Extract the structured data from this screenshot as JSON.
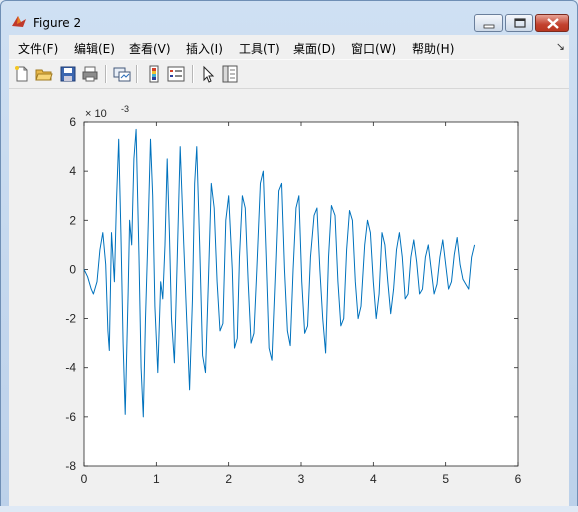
{
  "window": {
    "title": "Figure 2"
  },
  "menus": [
    {
      "label": "文件(F)",
      "key": "file"
    },
    {
      "label": "编辑(E)",
      "key": "edit"
    },
    {
      "label": "查看(V)",
      "key": "view"
    },
    {
      "label": "插入(I)",
      "key": "insert"
    },
    {
      "label": "工具(T)",
      "key": "tools"
    },
    {
      "label": "桌面(D)",
      "key": "desktop"
    },
    {
      "label": "窗口(W)",
      "key": "window"
    },
    {
      "label": "帮助(H)",
      "key": "help"
    }
  ],
  "toolbar": {
    "buttons": [
      "new-figure-icon",
      "open-file-icon",
      "save-icon",
      "print-icon",
      "link-plot-icon",
      "insert-colorbar-icon",
      "insert-legend-icon",
      "edit-plot-arrow-icon",
      "property-inspector-icon"
    ]
  },
  "colors": {
    "line": "#0072bd",
    "axes_bg": "#ffffff",
    "figure_bg": "#f0f0f0"
  },
  "chart_data": {
    "type": "line",
    "exponent_label": "× 10",
    "exponent_power": "-3",
    "xlim": [
      0,
      6
    ],
    "ylim": [
      -8,
      6
    ],
    "x_ticks": [
      "0",
      "1",
      "2",
      "3",
      "4",
      "5",
      "6"
    ],
    "y_ticks": [
      "6",
      "4",
      "2",
      "0",
      "-2",
      "-4",
      "-6",
      "-8"
    ],
    "series": [
      {
        "x": [
          0,
          0.05,
          0.1,
          0.13,
          0.18,
          0.22,
          0.26,
          0.3,
          0.33,
          0.35,
          0.38,
          0.42,
          0.45,
          0.48,
          0.51,
          0.54,
          0.57,
          0.61,
          0.63,
          0.66,
          0.69,
          0.72,
          0.76,
          0.79,
          0.82,
          0.85,
          0.88,
          0.92,
          0.95,
          0.98,
          1.02,
          1.06,
          1.09,
          1.12,
          1.15,
          1.18,
          1.21,
          1.25,
          1.29,
          1.33,
          1.38,
          1.42,
          1.46,
          1.5,
          1.53,
          1.56,
          1.6,
          1.64,
          1.68,
          1.72,
          1.76,
          1.8,
          1.84,
          1.88,
          1.92,
          1.96,
          2.0,
          2.05,
          2.08,
          2.12,
          2.15,
          2.19,
          2.23,
          2.27,
          2.31,
          2.35,
          2.39,
          2.44,
          2.48,
          2.52,
          2.56,
          2.6,
          2.65,
          2.69,
          2.73,
          2.77,
          2.81,
          2.85,
          2.89,
          2.93,
          2.97,
          3.01,
          3.05,
          3.09,
          3.13,
          3.18,
          3.22,
          3.26,
          3.3,
          3.34,
          3.38,
          3.42,
          3.47,
          3.51,
          3.55,
          3.59,
          3.63,
          3.67,
          3.71,
          3.75,
          3.79,
          3.83,
          3.88,
          3.92,
          3.96,
          4.0,
          4.04,
          4.08,
          4.12,
          4.16,
          4.2,
          4.24,
          4.28,
          4.32,
          4.36,
          4.4,
          4.44,
          4.48,
          4.52,
          4.56,
          4.6,
          4.64,
          4.68,
          4.72,
          4.76,
          4.8,
          4.84,
          4.88,
          4.92,
          4.96,
          5.0,
          5.04,
          5.08,
          5.12,
          5.16,
          5.2,
          5.24,
          5.28,
          5.32,
          5.36,
          5.4
        ],
        "y": [
          0,
          -0.3,
          -0.8,
          -1.0,
          -0.5,
          0.8,
          1.5,
          0.2,
          -2.5,
          -3.3,
          1.5,
          -0.5,
          2.8,
          5.3,
          1.5,
          -3.0,
          -5.9,
          -1.0,
          2.0,
          1.0,
          4.5,
          5.7,
          0.5,
          -4.0,
          -6.0,
          -2.0,
          1.0,
          5.3,
          3.0,
          -1.5,
          -4.2,
          -0.5,
          -1.2,
          1.0,
          4.5,
          1.5,
          -2.0,
          -3.8,
          0.5,
          5.0,
          1.0,
          -2.0,
          -4.9,
          -1.2,
          3.5,
          5.0,
          1.0,
          -3.5,
          -4.2,
          -0.5,
          3.5,
          2.5,
          -0.5,
          -2.5,
          -2.2,
          2.0,
          3.0,
          0.0,
          -3.2,
          -2.8,
          0.5,
          3.0,
          2.5,
          -0.5,
          -3.0,
          -2.6,
          0.0,
          3.5,
          4.0,
          0.5,
          -3.2,
          -3.7,
          0.0,
          3.2,
          3.5,
          0.0,
          -2.5,
          -3.1,
          0.0,
          2.5,
          3.0,
          -0.5,
          -2.6,
          -2.3,
          0.5,
          2.2,
          2.5,
          0.0,
          -2.0,
          -3.4,
          0.5,
          2.6,
          2.2,
          -0.5,
          -2.3,
          -2.0,
          0.8,
          2.4,
          2.0,
          -0.5,
          -2.0,
          -1.5,
          1.0,
          2.0,
          1.5,
          -0.5,
          -2.0,
          -1.0,
          1.5,
          1.0,
          -0.5,
          -1.8,
          -0.8,
          0.8,
          1.5,
          0.5,
          -1.2,
          -1.0,
          0.5,
          1.2,
          0.3,
          -1.0,
          -0.8,
          0.5,
          1.0,
          0.0,
          -1.0,
          -0.6,
          0.5,
          1.2,
          0.2,
          -0.8,
          -0.5,
          0.6,
          1.3,
          0.2,
          -0.4,
          -0.6,
          -0.8,
          0.5,
          1.0
        ]
      }
    ]
  }
}
